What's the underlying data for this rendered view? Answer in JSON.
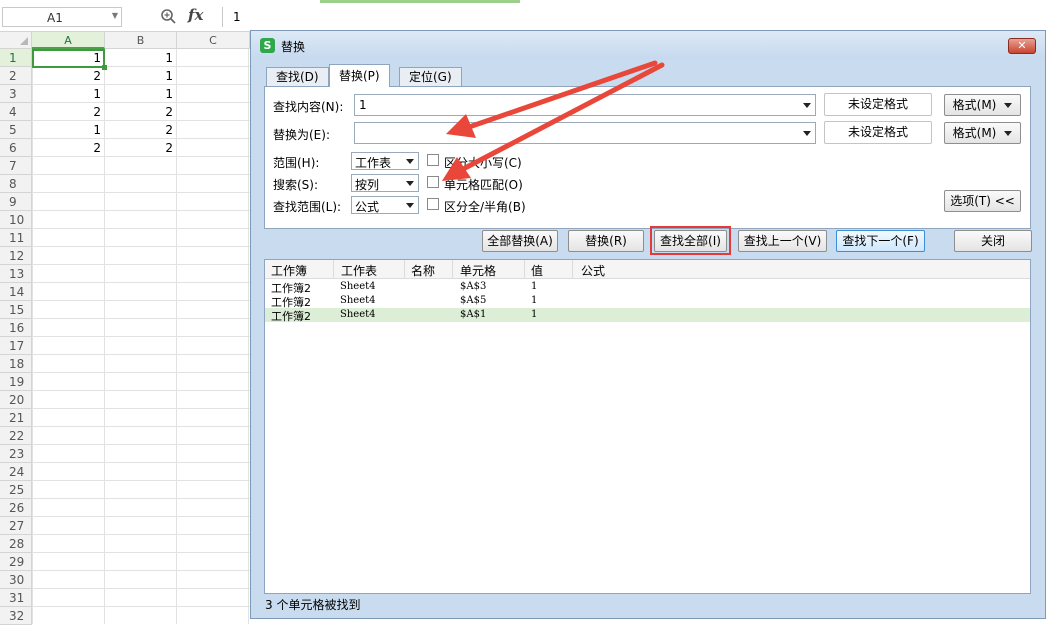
{
  "formula_bar": {
    "name_box": "A1",
    "fx": "fx",
    "formula_value": "1"
  },
  "sheet": {
    "columns": [
      "A",
      "B",
      "C"
    ],
    "rows": [
      "1",
      "2",
      "3",
      "4",
      "5",
      "6",
      "7",
      "8",
      "9",
      "10",
      "11",
      "12",
      "13",
      "14",
      "15",
      "16",
      "17",
      "18",
      "19",
      "20",
      "21",
      "22",
      "23",
      "24",
      "25",
      "26",
      "27",
      "28",
      "29",
      "30",
      "31",
      "32"
    ],
    "col_a": [
      "1",
      "2",
      "1",
      "2",
      "1",
      "2"
    ],
    "col_b": [
      "1",
      "1",
      "1",
      "2",
      "2",
      "2"
    ]
  },
  "dialog": {
    "title": "替换",
    "tabs": [
      {
        "label": "查找(D)"
      },
      {
        "label": "替换(P)"
      },
      {
        "label": "定位(G)"
      }
    ],
    "find_label": "查找内容(N):",
    "find_value": "1",
    "replace_label": "替换为(E):",
    "replace_value": "",
    "no_format_label": "未设定格式",
    "format_button": "格式(M)",
    "scope_label": "范围(H):",
    "scope_value": "工作表",
    "search_label": "搜索(S):",
    "search_value": "按列",
    "lookin_label": "查找范围(L):",
    "lookin_value": "公式",
    "match_case_label": "区分大小写(C)",
    "match_cell_label": "单元格匹配(O)",
    "match_width_label": "区分全/半角(B)",
    "options_button": "选项(T) <<",
    "buttons": {
      "replace_all": "全部替换(A)",
      "replace": "替换(R)",
      "find_all": "查找全部(I)",
      "find_prev": "查找上一个(V)",
      "find_next": "查找下一个(F)",
      "close": "关闭"
    },
    "results": {
      "headers": [
        "工作簿",
        "工作表",
        "名称",
        "单元格",
        "值",
        "公式"
      ],
      "rows": [
        {
          "workbook": "工作簿2",
          "sheet": "Sheet4",
          "name": "",
          "cell": "$A$3",
          "value": "1",
          "formula": ""
        },
        {
          "workbook": "工作簿2",
          "sheet": "Sheet4",
          "name": "",
          "cell": "$A$5",
          "value": "1",
          "formula": ""
        },
        {
          "workbook": "工作簿2",
          "sheet": "Sheet4",
          "name": "",
          "cell": "$A$1",
          "value": "1",
          "formula": ""
        }
      ]
    },
    "status": "3 个单元格被找到"
  },
  "colors": {
    "dialog_bg": "#c9dbef",
    "highlight_red": "#e53a3a",
    "selection_green": "#ddeed6",
    "active_cell_green": "#3f9a3f",
    "annotation_arrow": "#e8473a"
  }
}
